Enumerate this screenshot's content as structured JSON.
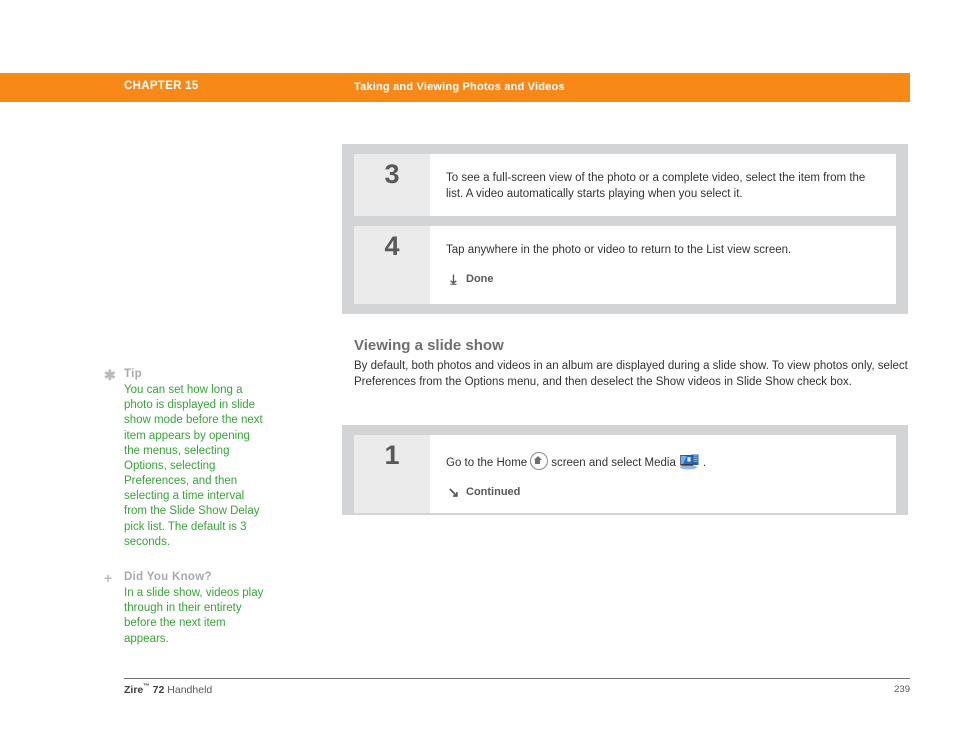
{
  "header": {
    "chapter": "CHAPTER 15",
    "title": "Taking and Viewing Photos and Videos",
    "bar_color": "#f98917"
  },
  "steps_top": [
    {
      "number": "3",
      "text": "To see a full-screen view of the photo or a complete video, select the item from the list. A video automatically starts playing when you select it."
    },
    {
      "number": "4",
      "text": "Tap anywhere in the photo or video to return to the List view screen.",
      "action": {
        "glyph": "⤓",
        "label": "Done"
      }
    }
  ],
  "section": {
    "heading": "Viewing a slide show",
    "paragraph": "By default, both photos and videos in an album are displayed during a slide show. To view photos only, select Preferences from the Options menu, and then deselect the Show videos in Slide Show check box."
  },
  "steps_bottom": [
    {
      "number": "1",
      "text_before_home": "Go to the Home",
      "text_between": "screen and select Media",
      "text_after_media": ".",
      "action": {
        "glyph": "↘",
        "label": "Continued"
      }
    }
  ],
  "notes": [
    {
      "bullet": "✱",
      "label": "Tip",
      "body": "You can set how long a photo is displayed in slide show mode before the next item appears by opening the menus, selecting Options, selecting Preferences, and then selecting a time interval from the Slide Show Delay pick list. The default is 3 seconds.",
      "text_color": "#36a536"
    },
    {
      "bullet": "+",
      "label": "Did You Know?",
      "body": "In a slide show, videos play through in their entirety before the next item appears.",
      "text_color": "#36a536"
    }
  ],
  "footer": {
    "brand": "Zire",
    "trademark": "™",
    "model": " 72",
    "product": " Handheld",
    "page_number": "239"
  },
  "icons": {
    "home": "home-icon",
    "media": "media-icon"
  }
}
